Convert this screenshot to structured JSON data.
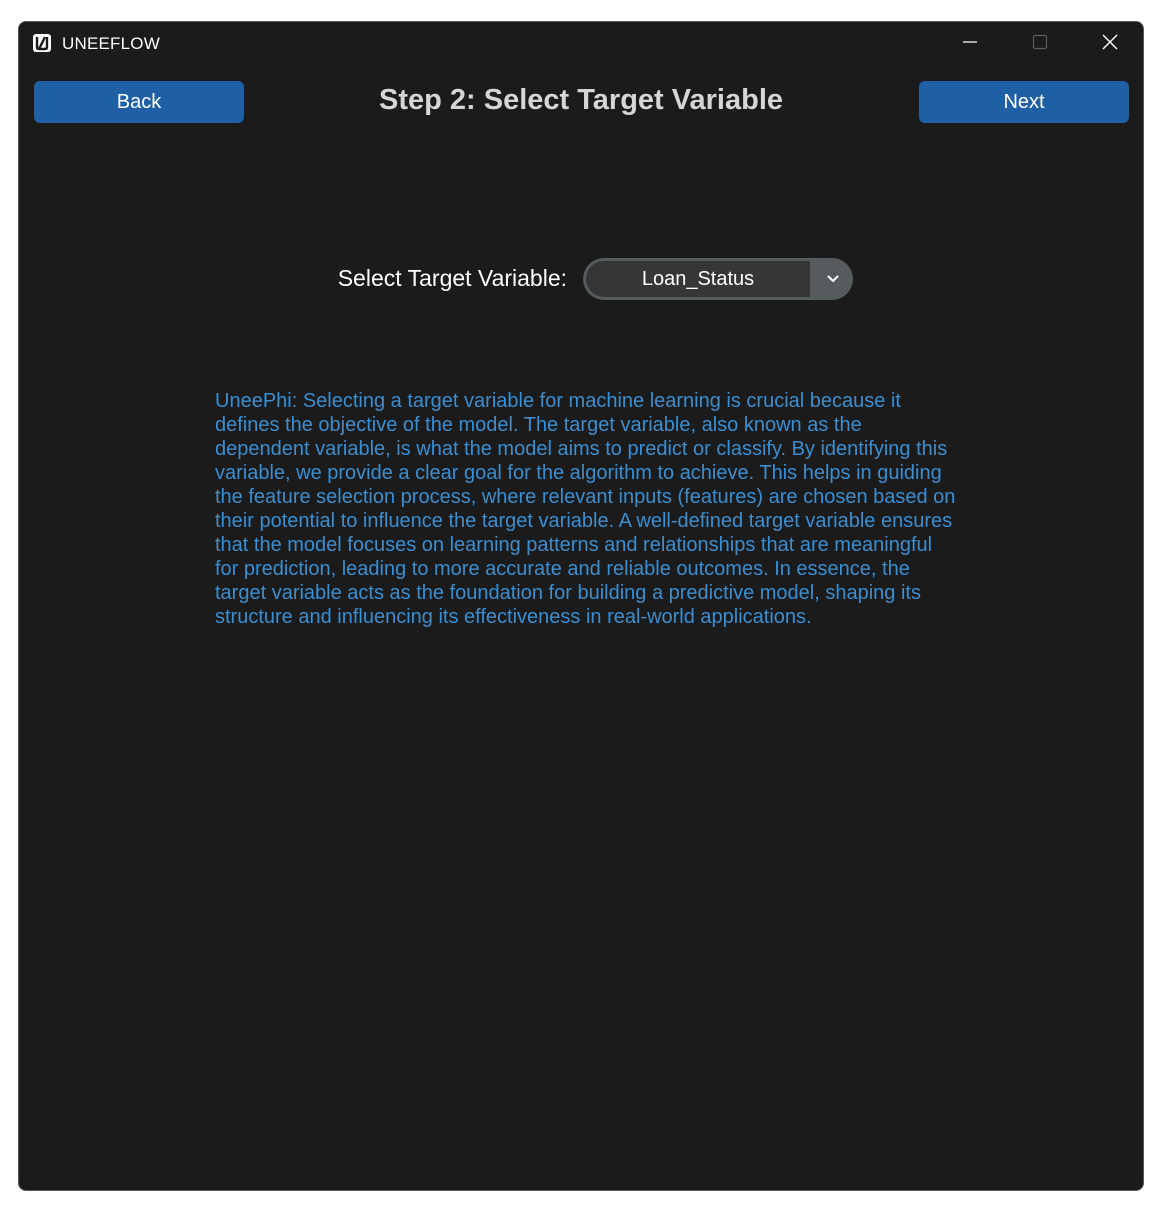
{
  "window": {
    "title": "UNEEFLOW"
  },
  "header": {
    "back_label": "Back",
    "next_label": "Next",
    "title": "Step 2: Select Target Variable"
  },
  "target": {
    "label": "Select Target Variable:",
    "selected_value": "Loan_Status"
  },
  "info": {
    "text": "UneePhi: Selecting a target variable for machine learning is crucial because it defines the objective of the model. The target variable, also known as the dependent variable, is what the model aims to predict or classify. By identifying this variable, we provide a clear goal for the algorithm to achieve. This helps in guiding the feature selection process, where relevant inputs (features) are chosen based on their potential to influence the target variable. A well-defined target variable ensures that the model focuses on learning patterns and relationships that are meaningful for prediction, leading to more accurate and reliable outcomes. In essence, the target variable acts as the foundation for building a predictive model, shaping its structure and influencing its effectiveness in real-world applications."
  },
  "icons": {
    "logo": "app-logo-icon",
    "minimize": "minimize-icon",
    "maximize": "maximize-icon",
    "close": "close-icon",
    "dropdown": "chevron-down-icon"
  },
  "colors": {
    "window_bg": "#1b1b1c",
    "button_bg": "#1f5fa6",
    "title_text": "#d6d6d6",
    "info_text": "#3b8ed0",
    "dropdown_field": "#343638",
    "dropdown_button": "#565b5e"
  }
}
